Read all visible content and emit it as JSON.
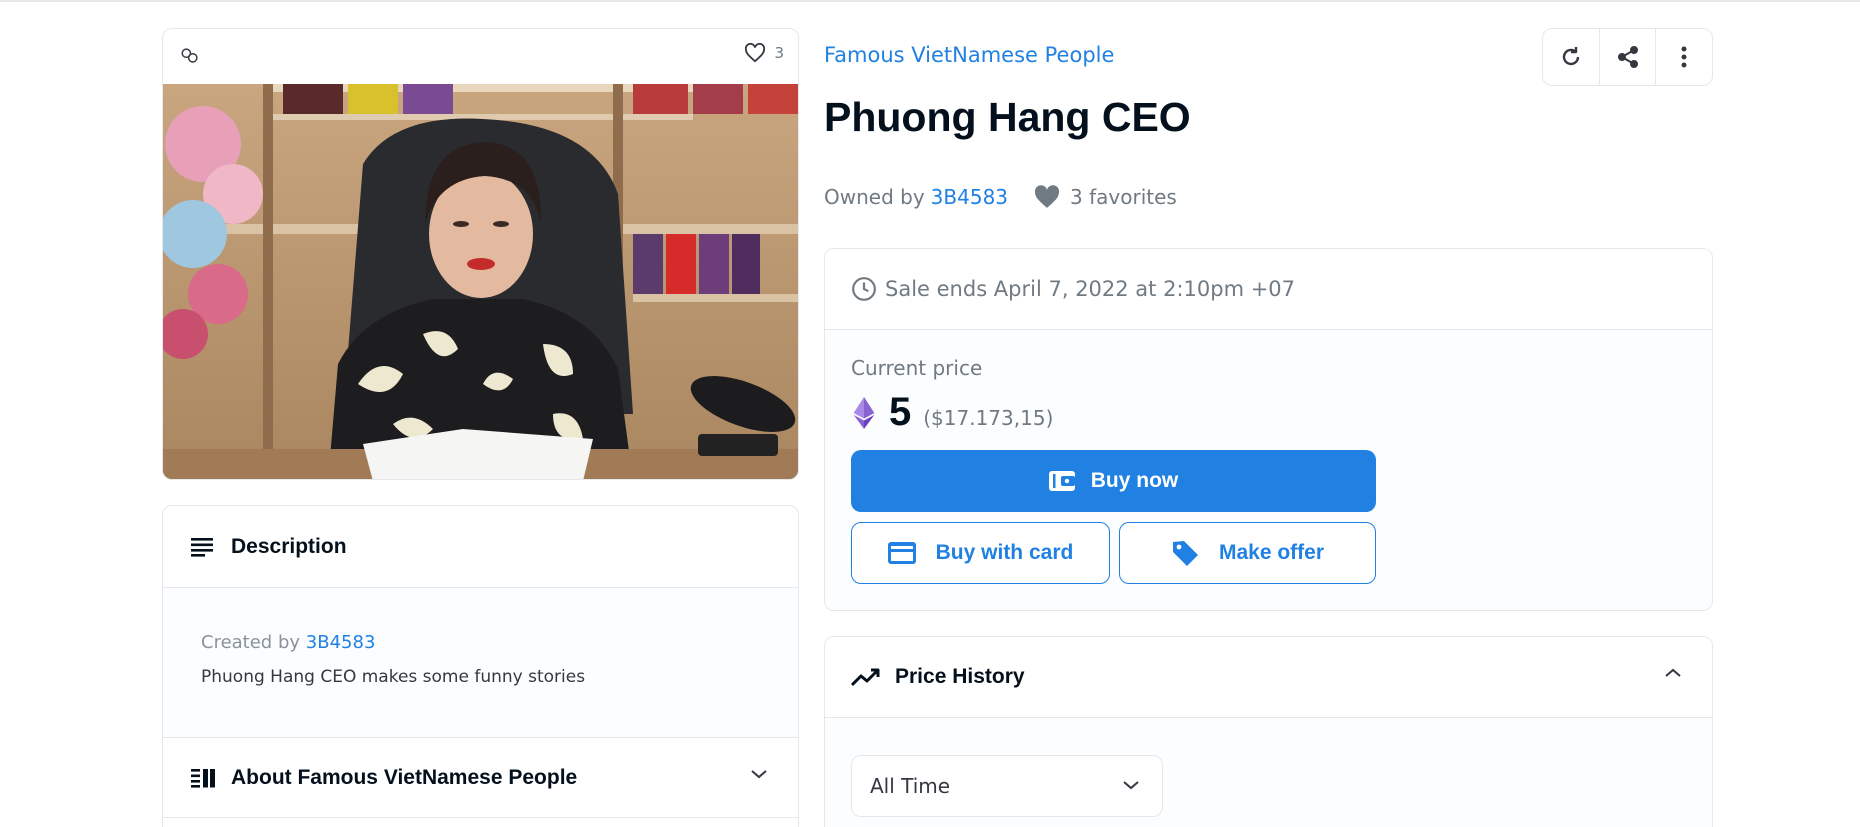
{
  "media": {
    "favorite_count": "3",
    "image_alt": "Woman seated at desk in front of bookshelf"
  },
  "description_panel": {
    "title": "Description",
    "created_by_label": "Created by",
    "creator": "3B4583",
    "text": "Phuong Hang CEO makes some funny stories"
  },
  "about_panel": {
    "title": "About Famous VietNamese People"
  },
  "item": {
    "collection": "Famous VietNamese People",
    "title": "Phuong Hang CEO",
    "owned_by_label": "Owned by",
    "owner": "3B4583",
    "favorites": "3 favorites"
  },
  "actions": {
    "icons": [
      "refresh-icon",
      "share-icon",
      "more-vertical-icon"
    ]
  },
  "sale": {
    "ends_text": "Sale ends April 7, 2022 at 2:10pm +07",
    "current_price_label": "Current price",
    "price": "5",
    "price_usd": "($17.173,15)",
    "buy_now_label": "Buy now",
    "buy_with_card_label": "Buy with card",
    "make_offer_label": "Make offer"
  },
  "price_history": {
    "title": "Price History",
    "range_selected": "All Time"
  },
  "colors": {
    "accent": "#2081e2",
    "text_dark": "#04111d",
    "text_muted": "#707a83",
    "border": "#e5e8eb"
  }
}
